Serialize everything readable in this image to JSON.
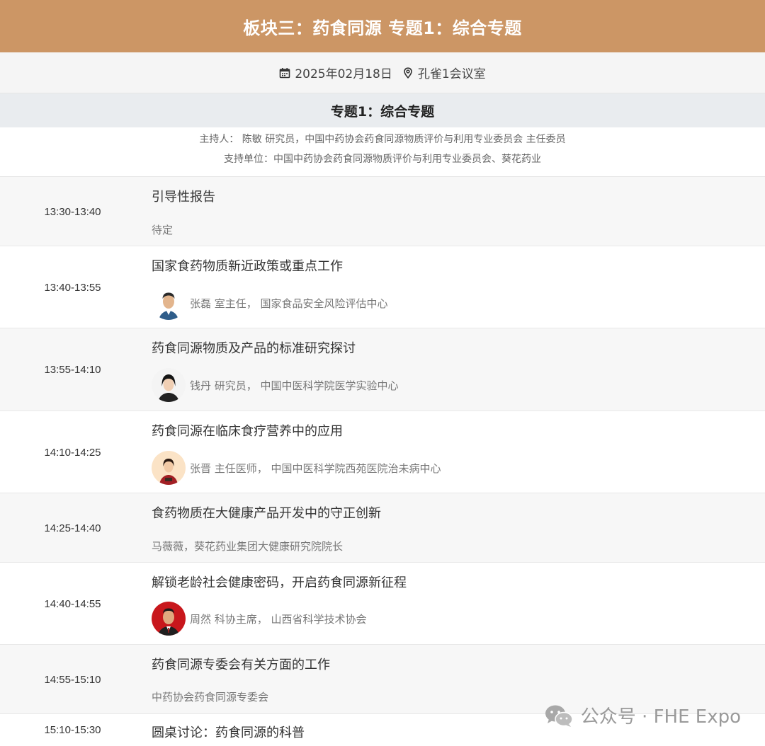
{
  "header": {
    "title": "板块三：药食同源 专题1：综合专题",
    "date": "2025年02月18日",
    "room": "孔雀1会议室",
    "date_icon": "calendar-icon",
    "room_icon": "location-pin-icon"
  },
  "session": {
    "title": "专题1：综合专题",
    "host": "主持人： 陈敏 研究员，中国中药协会药食同源物质评价与利用专业委员会 主任委员",
    "support": "支持单位：中国中药协会药食同源物质评价与利用专业委员会、葵花药业"
  },
  "schedule": [
    {
      "time": "13:30-13:40",
      "title": "引导性报告",
      "speaker": "待定"
    },
    {
      "time": "13:40-13:55",
      "title": "国家食药物质新近政策或重点工作",
      "speaker": "张磊 室主任， 国家食品安全风险评估中心"
    },
    {
      "time": "13:55-14:10",
      "title": "药食同源物质及产品的标准研究探讨",
      "speaker": "钱丹 研究员， 中国中医科学院医学实验中心"
    },
    {
      "time": "14:10-14:25",
      "title": "药食同源在临床食疗营养中的应用",
      "speaker": "张晋 主任医师， 中国中医科学院西苑医院治未病中心"
    },
    {
      "time": "14:25-14:40",
      "title": "食药物质在大健康产品开发中的守正创新",
      "speaker": "马薇薇，葵花药业集团大健康研究院院长"
    },
    {
      "time": "14:40-14:55",
      "title": "解锁老龄社会健康密码，开启药食同源新征程",
      "speaker": "周然 科协主席， 山西省科学技术协会"
    },
    {
      "time": "14:55-15:10",
      "title": "药食同源专委会有关方面的工作",
      "speaker": "中药协会药食同源专委会"
    },
    {
      "time": "15:10-15:30",
      "title": "圆桌讨论：药食同源的科普",
      "speaker": ""
    }
  ],
  "watermark": {
    "text": "公众号 · FHE Expo",
    "icon": "wechat-icon"
  },
  "colors": {
    "banner": "#cc9665",
    "meta_bar": "#f5f5f5",
    "session_head": "#e9ecef",
    "row_alt": "#f7f7f7"
  }
}
